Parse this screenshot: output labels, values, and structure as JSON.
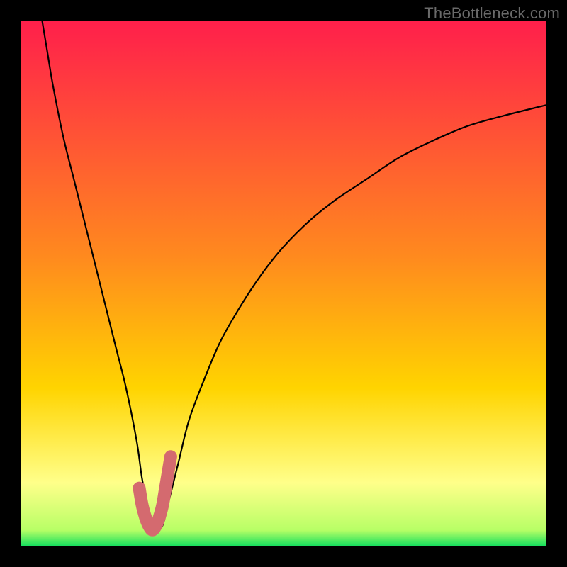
{
  "watermark": "TheBottleneck.com",
  "chart_data": {
    "type": "line",
    "title": "",
    "xlabel": "",
    "ylabel": "",
    "xlim": [
      0,
      100
    ],
    "ylim": [
      0,
      100
    ],
    "grid": false,
    "legend": false,
    "background_gradient": {
      "top_color": "#ff1f4b",
      "mid_color": "#ffd400",
      "low_color": "#ffff8a",
      "bottom_color": "#18e05e"
    },
    "series": [
      {
        "name": "bottleneck-curve",
        "x": [
          4,
          5,
          6,
          8,
          10,
          12,
          14,
          16,
          18,
          20,
          22,
          23,
          24,
          25,
          26,
          27,
          28,
          30,
          32,
          35,
          38,
          42,
          46,
          50,
          55,
          60,
          66,
          72,
          78,
          85,
          92,
          100
        ],
        "y": [
          100,
          94,
          88,
          78,
          70,
          62,
          54,
          46,
          38,
          30,
          20,
          13,
          8,
          4,
          3,
          4,
          8,
          16,
          24,
          32,
          39,
          46,
          52,
          57,
          62,
          66,
          70,
          74,
          77,
          80,
          82,
          84
        ]
      },
      {
        "name": "optimal-zone-highlight",
        "x": [
          22.5,
          23,
          23.5,
          24,
          24.5,
          25,
          25.5,
          26,
          26.5,
          27,
          27.5,
          28,
          28.5
        ],
        "y": [
          11,
          8,
          6,
          4.5,
          3.5,
          3,
          3.5,
          4.5,
          6,
          8,
          11,
          14,
          17
        ]
      }
    ],
    "annotations": []
  },
  "colors": {
    "curve": "#000000",
    "highlight": "#d46a6f",
    "frame": "#000000"
  }
}
